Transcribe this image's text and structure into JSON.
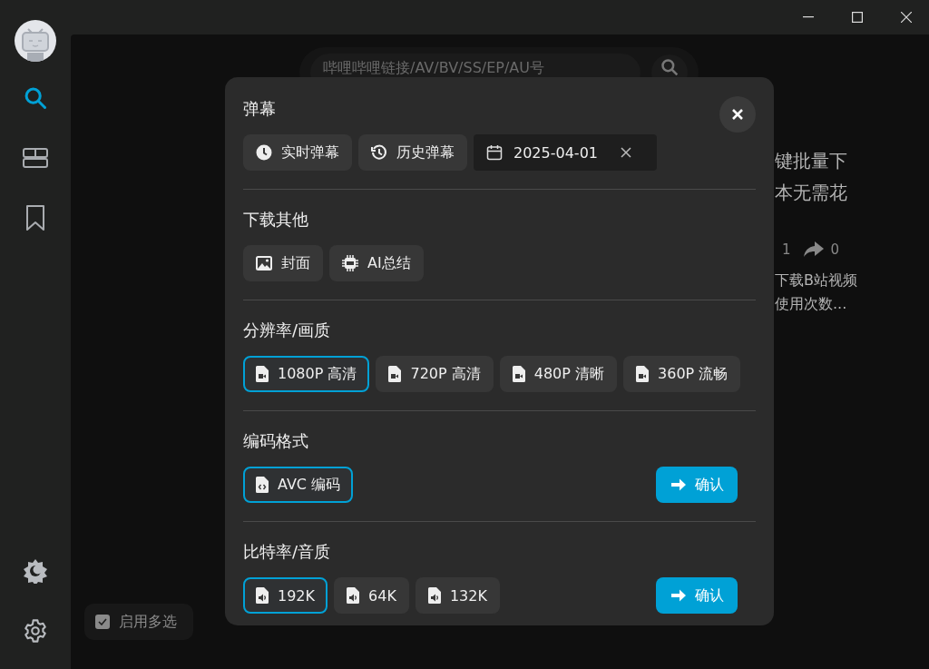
{
  "sidebar": {
    "items": [
      {
        "kind": "search",
        "selected": true
      },
      {
        "kind": "layout",
        "selected": false
      },
      {
        "kind": "bookmark",
        "selected": false
      }
    ],
    "bottom": [
      {
        "kind": "theme"
      },
      {
        "kind": "settings"
      }
    ]
  },
  "search": {
    "placeholder": "哔哩哔哩链接/AV/BV/SS/EP/AU号"
  },
  "video_card": {
    "title_lines": [
      "键批量下",
      "本无需花"
    ],
    "likes": "1",
    "shares": "0",
    "desc_lines": [
      "下载B站视频",
      "使用次数..."
    ]
  },
  "multi_select": {
    "label": "启用多选",
    "checked": true
  },
  "dialog": {
    "sections": [
      {
        "title": "弹幕",
        "options": [
          {
            "kind": "clock",
            "label": "实时弹幕",
            "selected": false
          },
          {
            "kind": "history",
            "label": "历史弹幕",
            "selected": false
          },
          {
            "kind": "date",
            "value": "2025-04-01"
          }
        ]
      },
      {
        "title": "下载其他",
        "options": [
          {
            "kind": "image",
            "label": "封面",
            "selected": false
          },
          {
            "kind": "ai",
            "label": "AI总结",
            "selected": false
          }
        ]
      },
      {
        "title": "分辨率/画质",
        "options": [
          {
            "kind": "video",
            "label": "1080P 高清",
            "selected": true
          },
          {
            "kind": "video",
            "label": "720P 高清",
            "selected": false
          },
          {
            "kind": "video",
            "label": "480P 清晰",
            "selected": false
          },
          {
            "kind": "video",
            "label": "360P 流畅",
            "selected": false
          }
        ]
      },
      {
        "title": "编码格式",
        "options": [
          {
            "kind": "code",
            "label": "AVC 编码",
            "selected": true
          }
        ],
        "confirm": "确认"
      },
      {
        "title": "比特率/音质",
        "options": [
          {
            "kind": "audio",
            "label": "192K",
            "selected": true
          },
          {
            "kind": "audio",
            "label": "64K",
            "selected": false
          },
          {
            "kind": "audio",
            "label": "132K",
            "selected": false
          }
        ],
        "confirm": "确认"
      }
    ]
  }
}
